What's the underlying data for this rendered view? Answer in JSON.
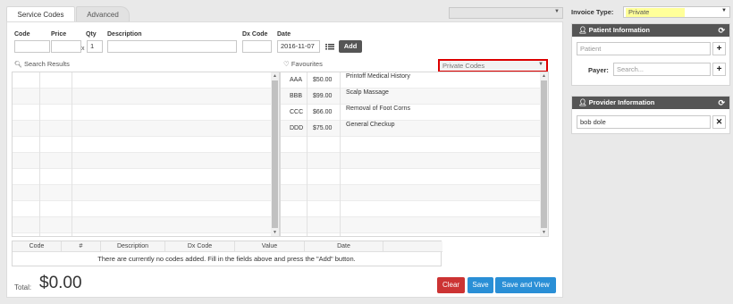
{
  "tabs": [
    {
      "label": "Service Codes",
      "active": true
    },
    {
      "label": "Advanced",
      "active": false
    }
  ],
  "top_dropdown": {
    "value": ""
  },
  "invoice_type": {
    "label": "Invoice Type:",
    "value": "Private",
    "highlight": "#ffff99"
  },
  "entry_form": {
    "code_label": "Code",
    "price_label": "Price",
    "qty_label": "Qty",
    "qty_value": "1",
    "x_symbol": "x",
    "description_label": "Description",
    "dx_code_label": "Dx Code",
    "date_label": "Date",
    "date_value": "2016-11-07",
    "add_label": "Add"
  },
  "search_results": {
    "label": "Search Results"
  },
  "favourites": {
    "label": "Favourites",
    "filter_value": "Private Codes",
    "filter_border_color": "#dd0000",
    "items": [
      {
        "code": "AAA",
        "price": "$50.00",
        "description": "Printoff Medical History"
      },
      {
        "code": "BBB",
        "price": "$99.00",
        "description": "Scalp Massage"
      },
      {
        "code": "CCC",
        "price": "$66.00",
        "description": "Removal of Foot Corns"
      },
      {
        "code": "DDD",
        "price": "$75.00",
        "description": "General Checkup"
      }
    ]
  },
  "codes_table": {
    "columns": [
      "Code",
      "#",
      "Description",
      "Dx Code",
      "Value",
      "Date"
    ],
    "empty_message": "There are currently no codes added. Fill in the fields above and press the \"Add\" button."
  },
  "total": {
    "label": "Total:",
    "value": "$0.00"
  },
  "actions": {
    "clear": "Clear",
    "save": "Save",
    "save_and_view": "Save and View",
    "clear_color": "#cc3333",
    "save_color": "#2a8fd6"
  },
  "patient": {
    "title": "Patient Information",
    "placeholder": "Patient",
    "payer_label": "Payer:",
    "payer_placeholder": "Search..."
  },
  "provider": {
    "title": "Provider Information",
    "value": "bob dole"
  }
}
